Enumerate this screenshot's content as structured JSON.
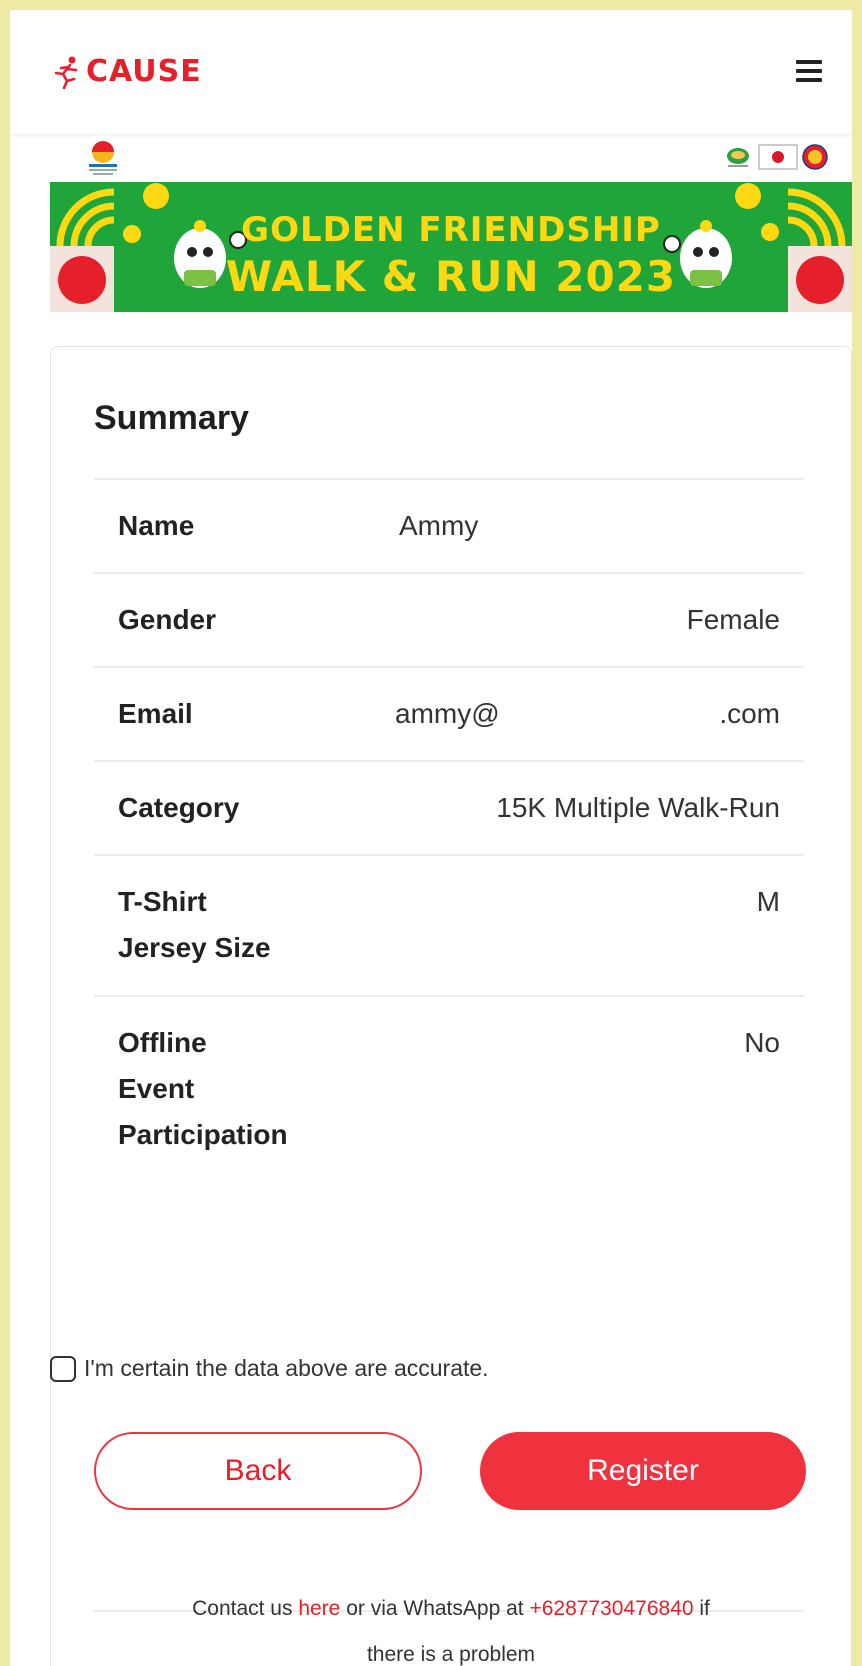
{
  "header": {
    "brand": "CAUSE",
    "menu_icon": "hamburger-menu-icon"
  },
  "banner": {
    "title_line1": "GOLDEN FRIENDSHIP",
    "title_line2": "WALK & RUN 2023",
    "colors": {
      "green": "#1fa53a",
      "yellow": "#ffd814",
      "red": "#e5202b"
    }
  },
  "summary": {
    "title": "Summary",
    "rows": [
      {
        "label": "Name",
        "value": "Ammy"
      },
      {
        "label": "Gender",
        "value": "Female"
      },
      {
        "label": "Email",
        "value_prefix": "ammy@",
        "value_suffix": ".com"
      },
      {
        "label": "Category",
        "value": "15K Multiple Walk-Run"
      },
      {
        "label_line1": "T-Shirt",
        "label_line2": "Jersey Size",
        "value": "M"
      },
      {
        "label_line1": "Offline",
        "label_line2": "Event",
        "label_line3": "Participation",
        "value": "No"
      }
    ]
  },
  "confirm": {
    "label": "I'm certain the data above are accurate.",
    "checked": false
  },
  "buttons": {
    "back": "Back",
    "register": "Register"
  },
  "footer": {
    "text1": "Contact us ",
    "here_link": "here",
    "text2": " or via WhatsApp at ",
    "phone": "+6287730476840",
    "text3": " if",
    "line2": "there is a problem"
  },
  "colors": {
    "accent": "#e5202b",
    "page_bg": "#eeeaa6"
  }
}
